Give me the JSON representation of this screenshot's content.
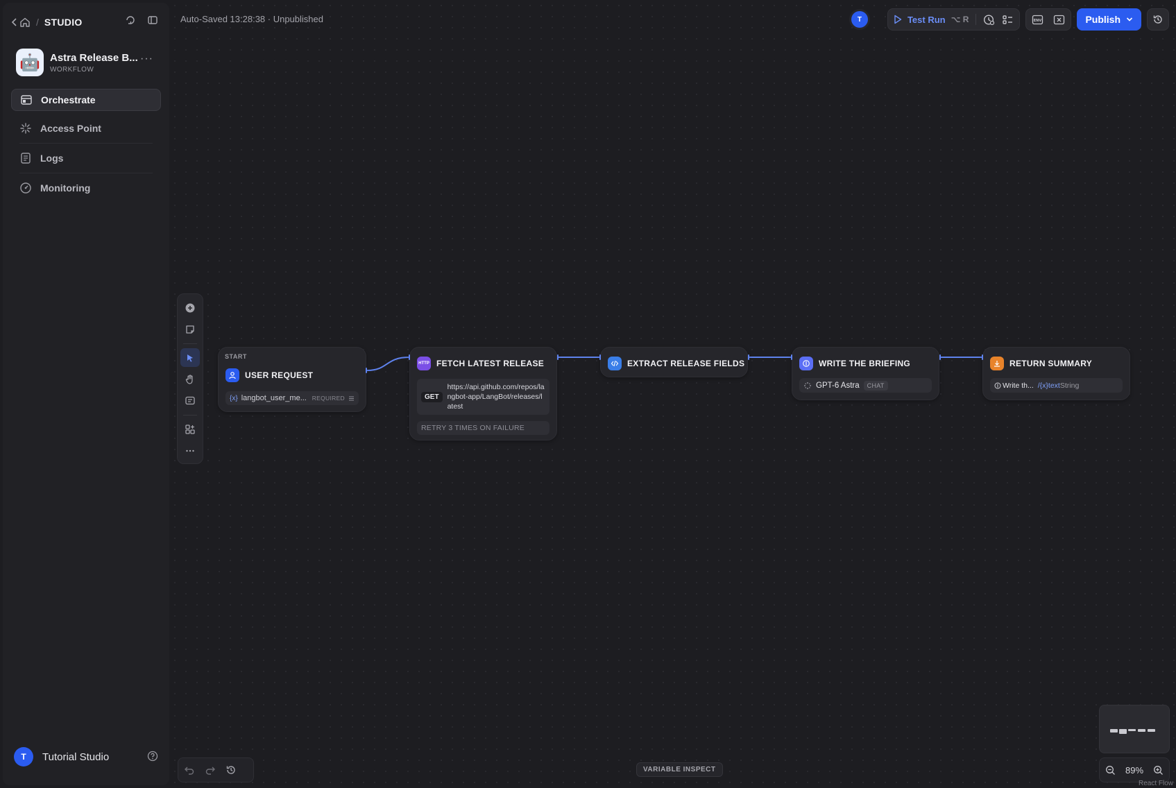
{
  "sidebar": {
    "breadcrumb_label": "STUDIO",
    "app": {
      "name": "Astra Release B...",
      "type": "WORKFLOW",
      "icon": "robot-emoji"
    },
    "nav": [
      {
        "label": "Orchestrate",
        "icon": "layout-icon",
        "active": true
      },
      {
        "label": "Access Point",
        "icon": "sparkle-icon",
        "active": false
      },
      {
        "label": "Logs",
        "icon": "document-icon",
        "active": false
      },
      {
        "label": "Monitoring",
        "icon": "gauge-icon",
        "active": false
      }
    ],
    "footer": {
      "avatar_initial": "T",
      "workspace_name": "Tutorial Studio"
    }
  },
  "topbar": {
    "autosave": "Auto-Saved 13:28:38 · Unpublished",
    "avatar_initial": "T",
    "test_run_label": "Test Run",
    "test_run_shortcut": "⌥ R",
    "publish_label": "Publish"
  },
  "nodes": {
    "start": {
      "kicker": "START",
      "title": "USER REQUEST",
      "variable": "langbot_user_me...",
      "required_label": "REQUIRED"
    },
    "http": {
      "icon_text": "HTTP",
      "title": "FETCH LATEST RELEASE",
      "method": "GET",
      "url": "https://api.github.com/repos/langbot-app/LangBot/releases/latest",
      "retry": "RETRY 3 TIMES ON FAILURE"
    },
    "code": {
      "title": "EXTRACT RELEASE FIELDS"
    },
    "llm": {
      "title": "WRITE THE BRIEFING",
      "model": "GPT-6 Astra",
      "mode": "CHAT"
    },
    "end": {
      "title": "RETURN SUMMARY",
      "output_name": "Write th...",
      "output_var": "text",
      "output_type": "String"
    }
  },
  "bottom": {
    "variable_inspect": "VARIABLE INSPECT",
    "zoom": "89%",
    "attribution": "React Flow"
  },
  "colors": {
    "accent": "#2b5cf0",
    "node_start": "#2b5cf0",
    "node_http": "#7b4fe6",
    "node_code": "#3a7ee8",
    "node_llm": "#5b6ef5",
    "node_end": "#e8832a",
    "edge": "#5f83ee"
  }
}
